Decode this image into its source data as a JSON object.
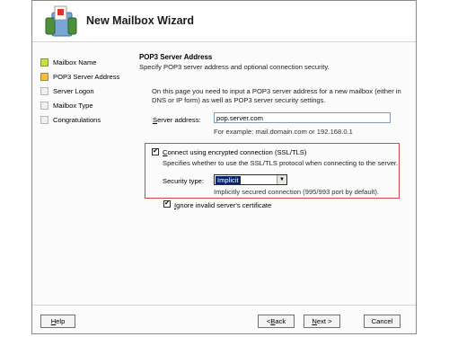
{
  "window": {
    "title": "New Mailbox Wizard"
  },
  "nav": {
    "items": [
      {
        "label": "Mailbox Name",
        "state": "done"
      },
      {
        "label": "POP3 Server Address",
        "state": "current"
      },
      {
        "label": "Server Logon",
        "state": "pending"
      },
      {
        "label": "Mailbox Type",
        "state": "pending"
      },
      {
        "label": "Congratulations",
        "state": "pending"
      }
    ]
  },
  "page": {
    "title": "POP3 Server Address",
    "subtitle": "Specify POP3 server address and optional connection security.",
    "description": "On this page you need to input a POP3 server address for a new mailbox (either in DNS or IP form) as well as POP3 server security settings."
  },
  "server_address": {
    "label_mnemonic": "S",
    "label_rest": "erver address:",
    "value": "pop.server.com",
    "hint": "For example: mail.domain.com or 192.168.0.1"
  },
  "ssl": {
    "checked": true,
    "check_glyph": "✔",
    "label_mnemonic": "C",
    "label_rest": "onnect using encrypted connection (SSL/TLS)",
    "description": "Specifies whether to use the SSL/TLS protocol when connecting to the server.",
    "security_type_label": "Security type:",
    "security_type_value": "Implicit",
    "arrow_glyph": "▼",
    "security_type_hint": "Implicitly secured connection (995/993 port by default)."
  },
  "certificate": {
    "checked": true,
    "check_glyph": "✔",
    "label_mnemonic": "I",
    "label_rest": "gnore invalid server's certificate"
  },
  "buttons": {
    "help": {
      "mnemonic": "H",
      "rest": "elp"
    },
    "back": {
      "prefix": "< ",
      "mnemonic": "B",
      "rest": "ack"
    },
    "next": {
      "mnemonic": "N",
      "rest": "ext >"
    },
    "cancel": {
      "label": "Cancel"
    }
  },
  "colors": {
    "done": "#cde03e",
    "current": "#f4c044",
    "pending": "#efefef",
    "highlight_frame": "#d04848",
    "selection": "#0a246a"
  }
}
